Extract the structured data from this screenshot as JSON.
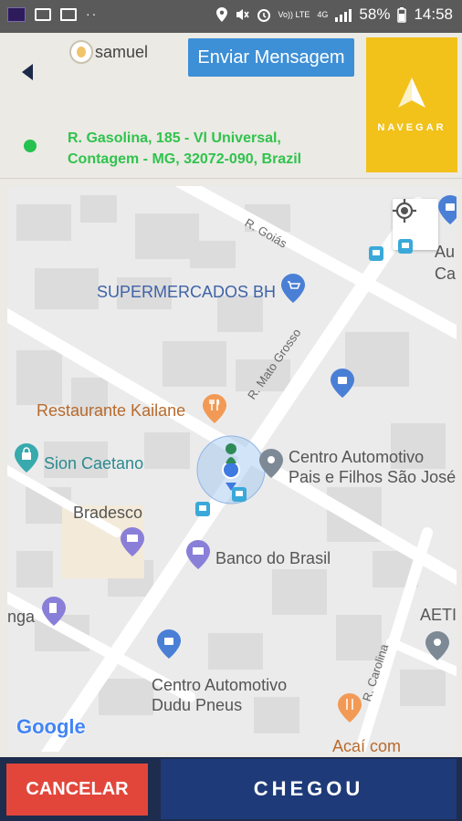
{
  "status_bar": {
    "network_label": "Vo)) LTE",
    "network_type": "4G",
    "battery": "58%",
    "time": "14:58"
  },
  "header": {
    "username": "samuel",
    "send_message_label": "Enviar Mensagem",
    "navigate_label": "NAVEGAR",
    "address_line1": "R. Gasolina, 185 - Vl Universal,",
    "address_line2": "Contagem - MG, 32072-090, Brazil"
  },
  "map": {
    "streets": {
      "goias": "R. Goiás",
      "mato_grosso": "R. Mato Grosso",
      "carolina": "R. Carolina"
    },
    "places": {
      "supermercados": "SUPERMERCADOS BH",
      "restaurante": "Restaurante Kailane",
      "sion": "Sion Caetano",
      "centro_pais_1": "Centro Automotivo",
      "centro_pais_2": "Pais e Filhos São José",
      "bradesco": "Bradesco",
      "banco_brasil": "Banco do Brasil",
      "unga": "nga",
      "aeti": "AETI",
      "dudu_1": "Centro Automotivo",
      "dudu_2": "Dudu Pneus",
      "acai": "Açaí com",
      "top_right_1": "Au",
      "top_right_2": "Ca"
    },
    "attribution": "Google"
  },
  "footer": {
    "cancel_label": "CANCELAR",
    "arrived_label": "CHEGOU"
  },
  "colors": {
    "accent_yellow": "#f2c21b",
    "message_blue": "#3d8fd6",
    "address_green": "#2fc34d",
    "cancel_red": "#e2463b",
    "navy": "#1e3a78"
  }
}
